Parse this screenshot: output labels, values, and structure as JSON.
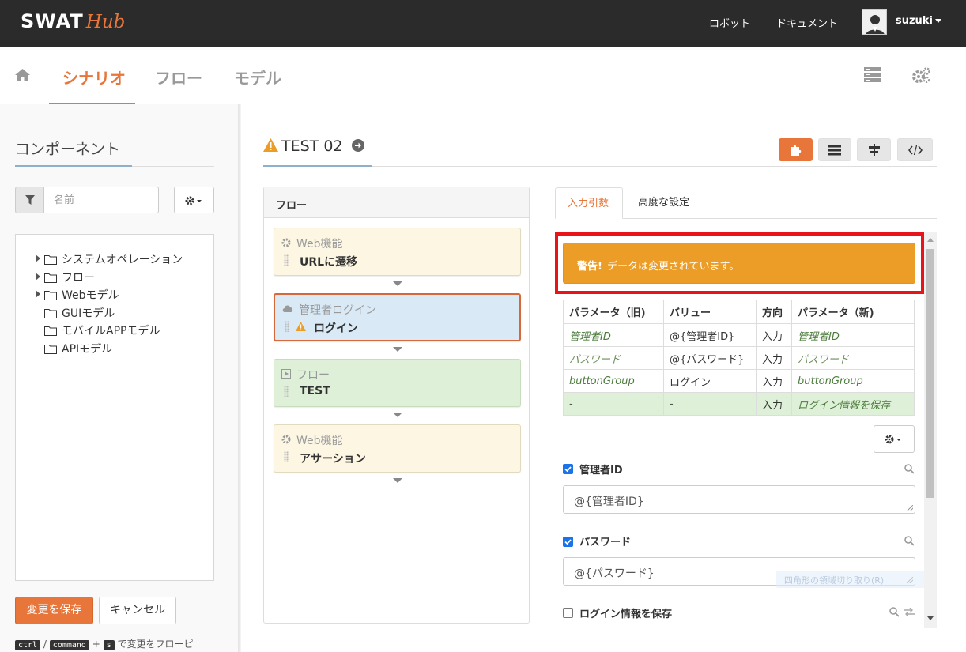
{
  "app": {
    "logo_main": "SWAT",
    "logo_sub": "Hub"
  },
  "topbar": {
    "links": [
      "ロボット",
      "ドキュメント"
    ],
    "username": "suzuki"
  },
  "nav": {
    "tabs": [
      "シナリオ",
      "フロー",
      "モデル"
    ],
    "active_tab": "シナリオ"
  },
  "left": {
    "title": "コンポーネント",
    "search_placeholder": "名前",
    "tree": [
      {
        "label": "システムオペレーション",
        "expandable": true
      },
      {
        "label": "フロー",
        "expandable": true
      },
      {
        "label": "Webモデル",
        "expandable": true
      },
      {
        "label": "GUIモデル",
        "expandable": false
      },
      {
        "label": "モバイルAPPモデル",
        "expandable": false
      },
      {
        "label": "APIモデル",
        "expandable": false
      }
    ],
    "save_label": "変更を保存",
    "cancel_label": "キャンセル",
    "shortcut": {
      "key1": "ctrl",
      "sep": "/",
      "key2": "command",
      "plus": "+",
      "key3": "s",
      "text": "で変更をフローピ"
    }
  },
  "scenario": {
    "title": "TEST 02"
  },
  "flow": {
    "title": "フロー",
    "nodes": [
      {
        "type": "Web機能",
        "name": "URLに遷移",
        "kind": "web"
      },
      {
        "type": "管理者ログイン",
        "name": "ログイン",
        "kind": "login"
      },
      {
        "type": "フロー",
        "name": "TEST",
        "kind": "flow"
      },
      {
        "type": "Web機能",
        "name": "アサーション",
        "kind": "web"
      }
    ]
  },
  "tabs": {
    "active": "入力引数",
    "inactive": "高度な設定"
  },
  "alert": {
    "strong": "警告!",
    "text": "データは変更されています。"
  },
  "param_table": {
    "headers": [
      "パラメータ（旧)",
      "バリュー",
      "方向",
      "パラメータ（新)"
    ],
    "rows": [
      {
        "old": "管理者ID",
        "value": "@{管理者ID}",
        "dir": "入力",
        "new": "管理者ID"
      },
      {
        "old": "パスワード",
        "value": "@{パスワード}",
        "dir": "入力",
        "new": "パスワード"
      },
      {
        "old": "buttonGroup",
        "value": "ログイン",
        "dir": "入力",
        "new": "buttonGroup"
      },
      {
        "old": "-",
        "value": "-",
        "dir": "入力",
        "new": "ログイン情報を保存"
      }
    ]
  },
  "fields": [
    {
      "label": "管理者ID",
      "checked": true,
      "value": "@{管理者ID}"
    },
    {
      "label": "パスワード",
      "checked": true,
      "value": "@{パスワード}"
    },
    {
      "label": "ログイン情報を保存",
      "checked": false
    }
  ],
  "ghost_tip": "四角形の領域切り取り(R)",
  "colors": {
    "accent": "#e8763a",
    "alert": "#ec9d27",
    "highlight": "#e8141c",
    "web_node": "#fcf6e3",
    "login_node": "#d9eaf6",
    "flow_node": "#def0d8"
  }
}
